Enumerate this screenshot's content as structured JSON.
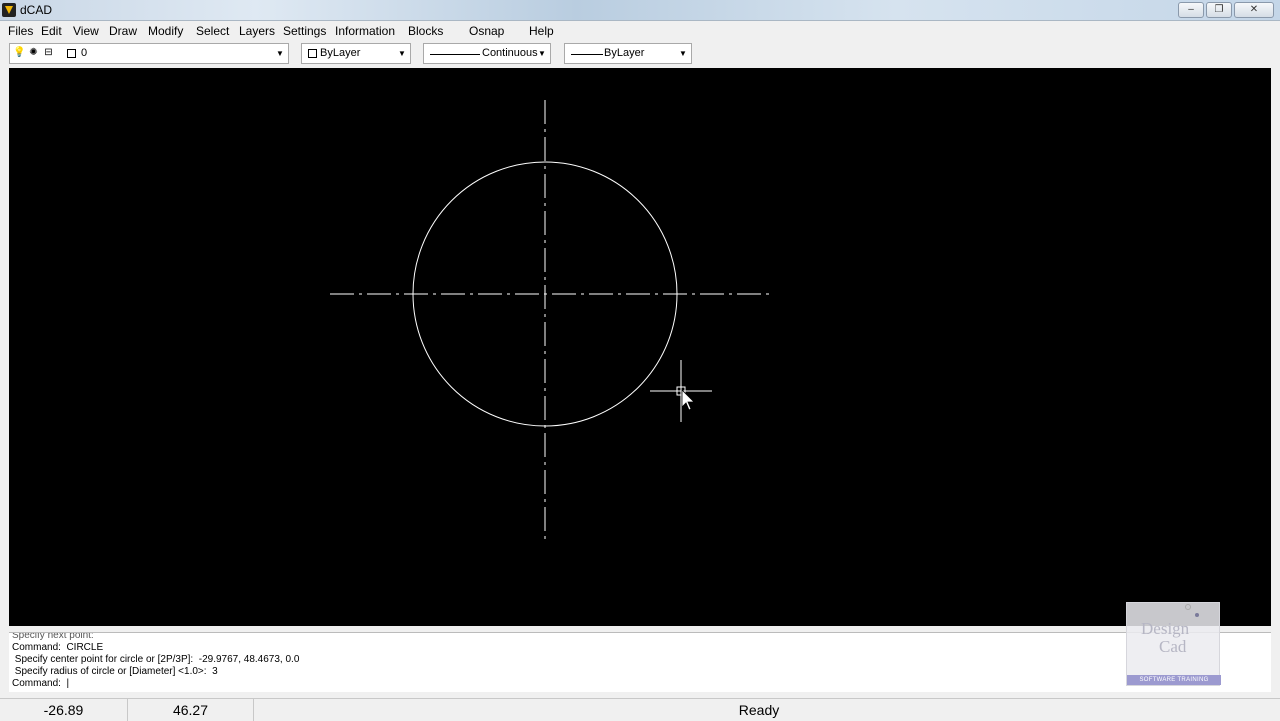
{
  "window": {
    "title": "dCAD",
    "minimize": "‒",
    "maximize": "❐",
    "close": "✕"
  },
  "menu": [
    "Files",
    "Edit",
    "View",
    "Draw",
    "Modify",
    "Select",
    "Layers",
    "Settings",
    "Information",
    "Blocks",
    "Osnap",
    "Help"
  ],
  "toolbar": {
    "layer_value": "0",
    "color_value": "ByLayer",
    "linetype_value": "Continuous",
    "lineweight_value": "ByLayer"
  },
  "command_history": [
    "Specify next point:",
    "Command:  CIRCLE",
    " Specify center point for circle or [2P/3P]:  -29.9767, 48.4673, 0.0",
    " Specify radius of circle or [Diameter] <1.0>:  3",
    "Command:  |"
  ],
  "status": {
    "x": "-26.89",
    "y": "46.27",
    "state": "Ready"
  },
  "logo": {
    "line1": "Design",
    "line2": "Cad",
    "tagline": "SOFTWARE TRAINING"
  },
  "colors": {
    "canvas_bg": "#000000",
    "entity": "#ffffff",
    "logo_strip": "#9c9ad0"
  }
}
